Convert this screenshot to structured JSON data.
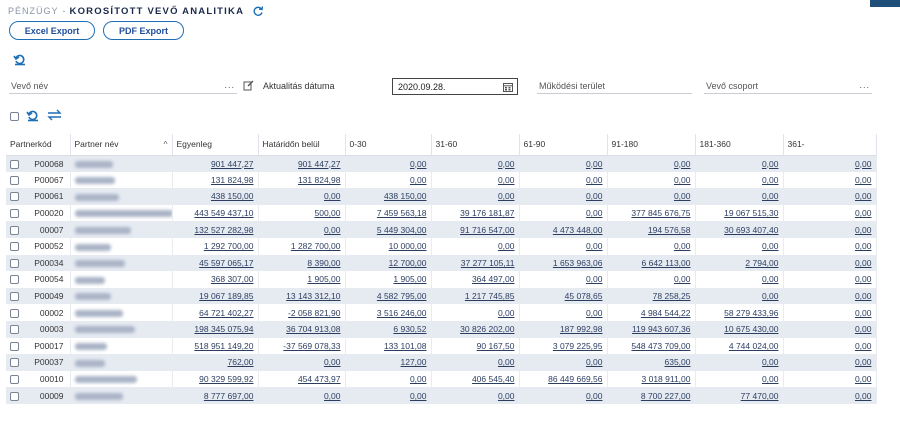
{
  "header": {
    "breadcrumb": "PÉNZÜGY",
    "separator": "-",
    "title": "KOROSÍTOTT VEVŐ ANALITIKA"
  },
  "toolbar": {
    "excel_label": "Excel Export",
    "pdf_label": "PDF Export"
  },
  "filters": {
    "vevo_nev_placeholder": "Vevő név",
    "vevo_nev_dots": "...",
    "aktualitas_label": "Aktualitás dátuma",
    "aktualitas_value": "2020.09.28.",
    "mukodesi_placeholder": "Működési terület",
    "vevo_csoport_placeholder": "Vevő csoport",
    "vevo_csoport_dots": "..."
  },
  "table": {
    "columns": [
      "Partnerkód",
      "Partner név",
      "Egyenleg",
      "Határidőn belül",
      "0-30",
      "31-60",
      "61-90",
      "91-180",
      "181-360",
      "361-"
    ],
    "rows": [
      {
        "code": "P00068",
        "name_width": 38,
        "v": [
          "901 447,27",
          "901 447,27",
          "0,00",
          "0,00",
          "0,00",
          "0,00",
          "0,00",
          "0,00"
        ]
      },
      {
        "code": "P00067",
        "name_width": 40,
        "v": [
          "131 824,98",
          "131 824,98",
          "0,00",
          "0,00",
          "0,00",
          "0,00",
          "0,00",
          "0,00"
        ]
      },
      {
        "code": "P00061",
        "name_width": 44,
        "v": [
          "438 150,00",
          "0,00",
          "438 150,00",
          "0,00",
          "0,00",
          "0,00",
          "0,00",
          "0,00"
        ]
      },
      {
        "code": "P00020",
        "name_width": 98,
        "v": [
          "443 549 437,10",
          "500,00",
          "7 459 563,18",
          "39 176 181,87",
          "0,00",
          "377 845 676,75",
          "19 067 515,30",
          "0,00"
        ]
      },
      {
        "code": "00007",
        "name_width": 56,
        "v": [
          "132 527 282,98",
          "0,00",
          "5 449 304,00",
          "91 716 547,00",
          "4 473 448,00",
          "194 576,58",
          "30 693 407,40",
          "0,00"
        ]
      },
      {
        "code": "P00052",
        "name_width": 36,
        "v": [
          "1 292 700,00",
          "1 282 700,00",
          "10 000,00",
          "0,00",
          "0,00",
          "0,00",
          "0,00",
          "0,00"
        ]
      },
      {
        "code": "P00034",
        "name_width": 50,
        "v": [
          "45 597 065,17",
          "8 390,00",
          "12 700,00",
          "37 277 105,11",
          "1 653 963,06",
          "6 642 113,00",
          "2 794,00",
          "0,00"
        ]
      },
      {
        "code": "P00054",
        "name_width": 30,
        "v": [
          "368 307,00",
          "1 905,00",
          "1 905,00",
          "364 497,00",
          "0,00",
          "0,00",
          "0,00",
          "0,00"
        ]
      },
      {
        "code": "P00049",
        "name_width": 36,
        "v": [
          "19 067 189,85",
          "13 143 312,10",
          "4 582 795,00",
          "1 217 745,85",
          "45 078,65",
          "78 258,25",
          "0,00",
          "0,00"
        ]
      },
      {
        "code": "00002",
        "name_width": 48,
        "v": [
          "64 721 402,27",
          "-2 058 821,90",
          "3 516 246,00",
          "0,00",
          "0,00",
          "4 984 544,22",
          "58 279 433,96",
          "0,00"
        ]
      },
      {
        "code": "00003",
        "name_width": 60,
        "v": [
          "198 345 075,94",
          "36 704 913,08",
          "6 930,52",
          "30 826 202,00",
          "187 992,98",
          "119 943 607,36",
          "10 675 430,00",
          "0,00"
        ]
      },
      {
        "code": "P00017",
        "name_width": 32,
        "v": [
          "518 951 149,20",
          "-37 569 078,33",
          "133 101,08",
          "90 167,50",
          "3 079 225,95",
          "548 473 709,00",
          "4 744 024,00",
          "0,00"
        ]
      },
      {
        "code": "P00037",
        "name_width": 30,
        "v": [
          "762,00",
          "0,00",
          "127,00",
          "0,00",
          "0,00",
          "635,00",
          "0,00",
          "0,00"
        ]
      },
      {
        "code": "00010",
        "name_width": 62,
        "v": [
          "90 329 599,92",
          "454 473,97",
          "0,00",
          "406 545,40",
          "86 449 669,56",
          "3 018 911,00",
          "0,00",
          "0,00"
        ]
      },
      {
        "code": "00009",
        "name_width": 48,
        "v": [
          "8 777 697,00",
          "0,00",
          "0,00",
          "0,00",
          "0,00",
          "8 700 227,00",
          "77 470,00",
          "0,00"
        ]
      }
    ]
  },
  "colors": {
    "accent": "#1f4e9c",
    "row_stripe": "#e6ebf2",
    "title": "#1b2a4a"
  }
}
